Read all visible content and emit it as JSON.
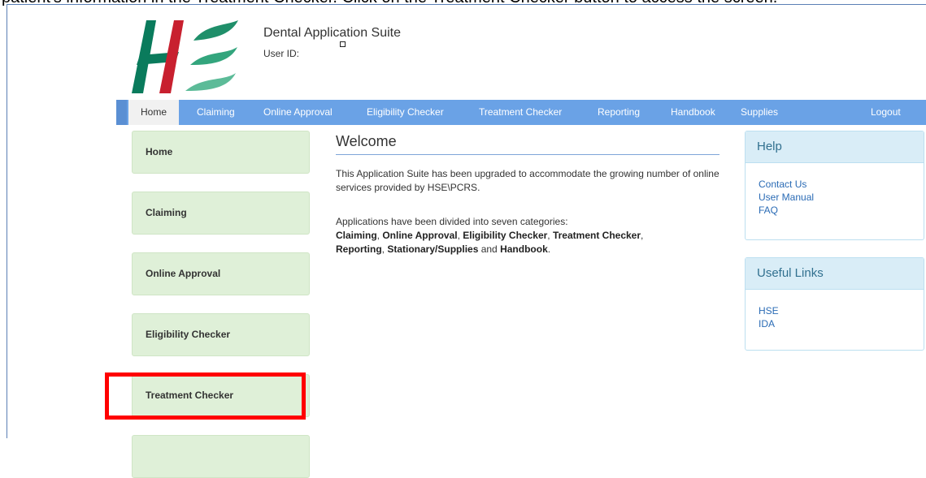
{
  "top_caption": "patient's information in the Treatment Checker. Click on the Treatment Checker button to access the screen.",
  "header": {
    "app_title": "Dental Application Suite",
    "user_id_label": "User ID:",
    "logo_text": "HSE"
  },
  "nav": {
    "items": [
      {
        "label": "Home"
      },
      {
        "label": "Claiming"
      },
      {
        "label": "Online Approval"
      },
      {
        "label": "Eligibility Checker"
      },
      {
        "label": "Treatment Checker"
      },
      {
        "label": "Reporting"
      },
      {
        "label": "Handbook"
      },
      {
        "label": "Supplies"
      },
      {
        "label": "Logout"
      }
    ]
  },
  "sidebar": {
    "items": [
      {
        "label": "Home"
      },
      {
        "label": "Claiming"
      },
      {
        "label": "Online Approval"
      },
      {
        "label": "Eligibility Checker"
      },
      {
        "label": "Treatment Checker"
      }
    ]
  },
  "welcome": {
    "title": "Welcome",
    "paragraph1": "This Application Suite has been upgraded to accommodate the growing number of online services provided by HSE\\PCRS.",
    "paragraph2_intro": "Applications have been divided into seven categories:",
    "categories": [
      "Claiming",
      "Online Approval",
      "Eligibility Checker",
      "Treatment Checker",
      "Reporting",
      "Stationary/Supplies",
      "Handbook"
    ],
    "sep_comma": ", ",
    "sep_and": " and ",
    "end": "."
  },
  "help_panel": {
    "title": "Help",
    "links": [
      "Contact Us",
      "User Manual",
      "FAQ"
    ]
  },
  "links_panel": {
    "title": "Useful Links",
    "links": [
      "HSE",
      "IDA"
    ]
  },
  "colors": {
    "nav_bg": "#6aa2e6",
    "side_btn_bg": "#dff0d8",
    "panel_head_bg": "#d9edf7",
    "highlight": "#ff0000",
    "logo_green": "#0a7b5c",
    "logo_red": "#c8202f"
  }
}
